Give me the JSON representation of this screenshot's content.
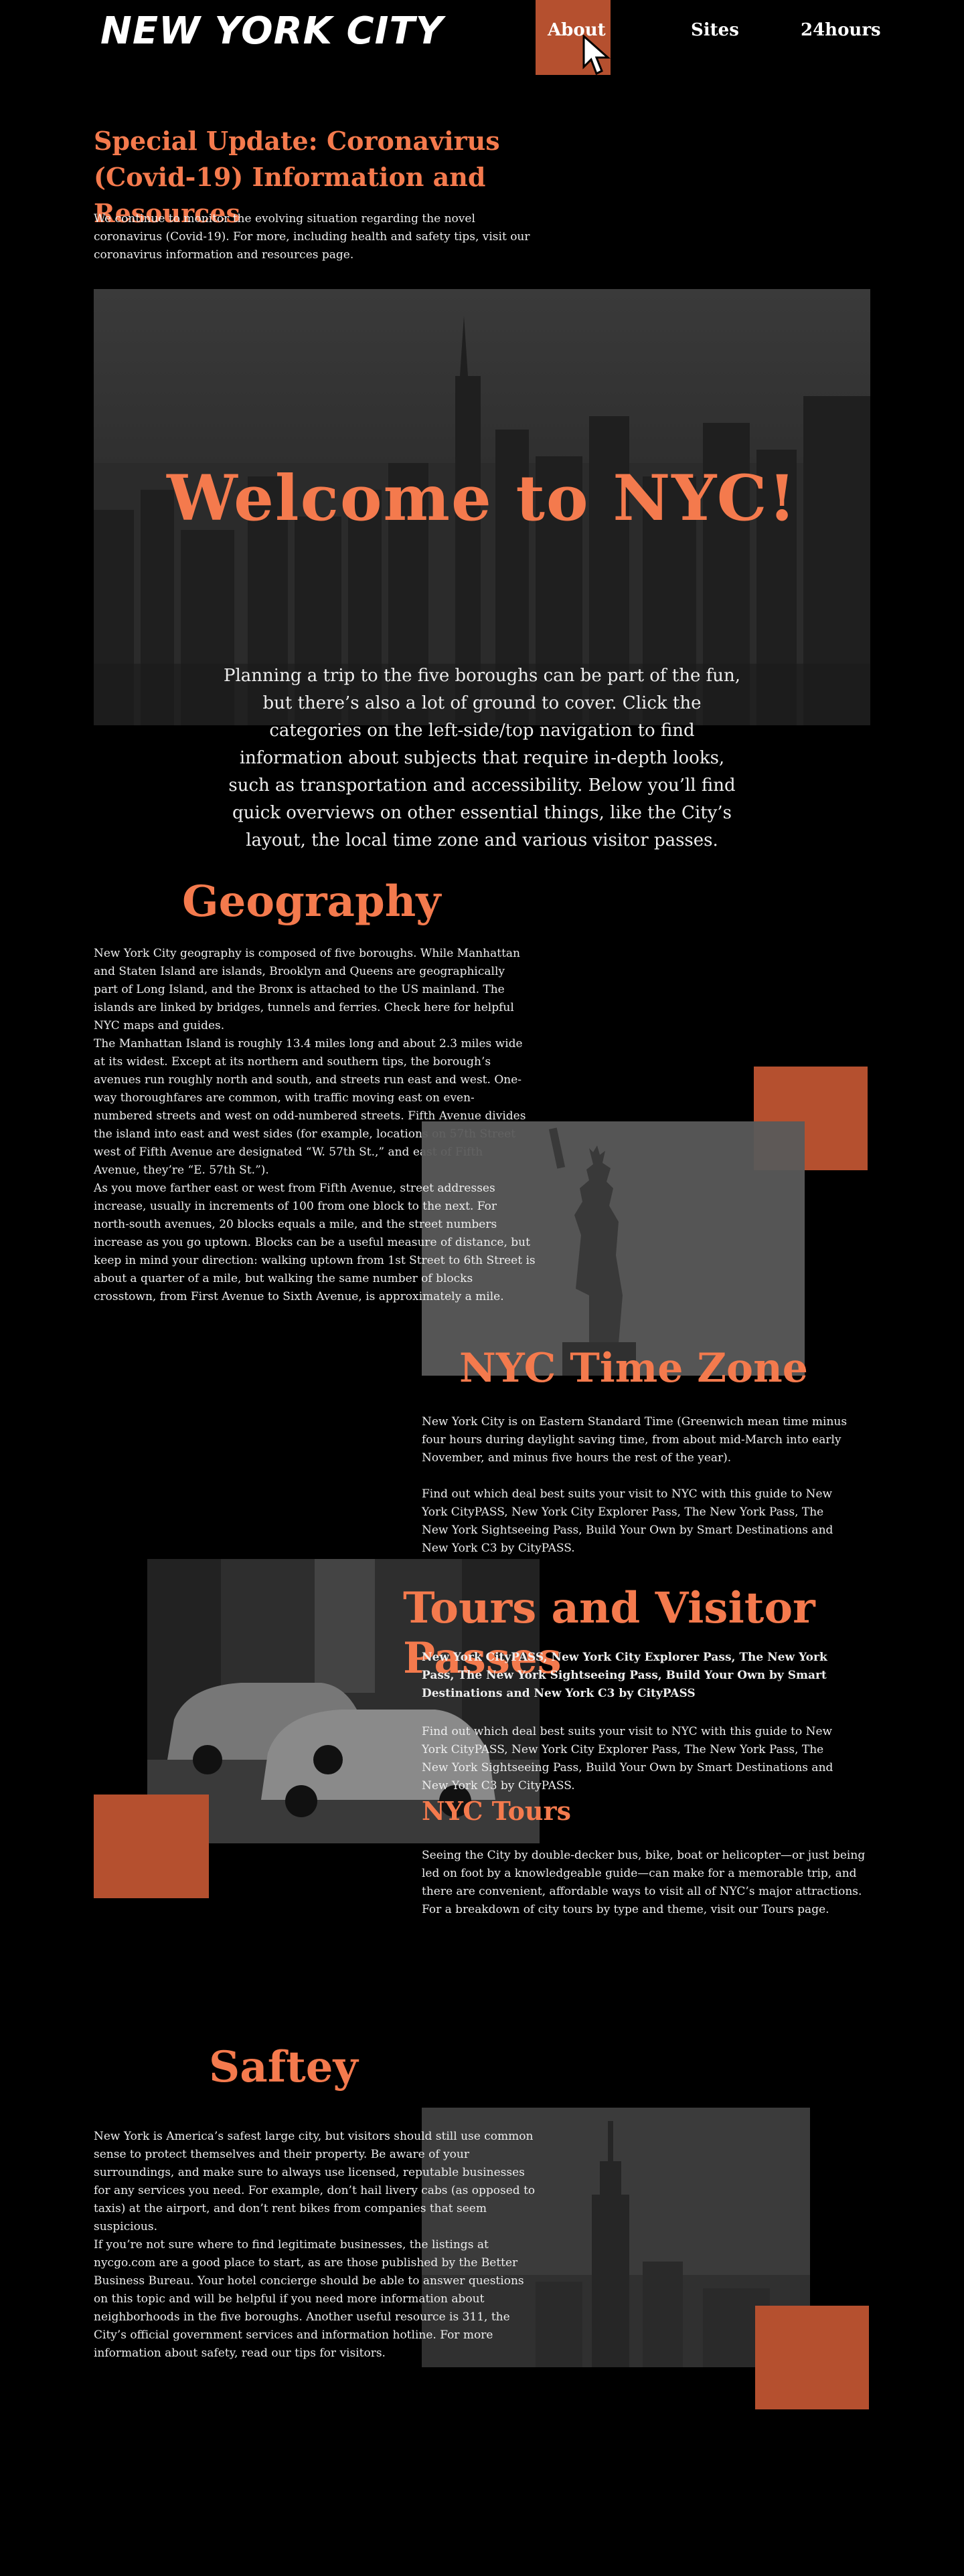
{
  "header": {
    "logo": "NEW YORK CITY",
    "nav": [
      "About",
      "Sites",
      "24hours"
    ]
  },
  "covid": {
    "title": "Special Update: Coronavirus (Covid-19) Information and Resources",
    "text": "We continue to monitor the evolving situation regarding the novel coronavirus (Covid-19). For more, including health and safety tips, visit our coronavirus information and resources page."
  },
  "hero": {
    "title": "Welcome to NYC!",
    "text": "Planning a trip to the five boroughs can be part of the fun, but there’s also a lot of ground to cover. Click the categories on the left-side/top navigation to find information about subjects that require in-depth looks, such as transportation and accessibility. Below you’ll find quick overviews on other essential things, like the City’s layout, the local time zone and various visitor passes."
  },
  "geography": {
    "title": "Geography",
    "p1": "New York City geography is composed of five boroughs.  While Manhattan and Staten Island are islands, Brooklyn and Queens are geographically part of Long Island, and the Bronx is attached to the US mainland. The islands are linked by bridges, tunnels and ferries. Check here for helpful NYC maps and guides.",
    "p2": "The Manhattan Island is roughly 13.4 miles long and about 2.3 miles wide at its widest. Except at its northern and southern tips, the borough’s avenues run roughly north and south, and streets run east and west. One-way thoroughfares are common, with traffic moving east on even-numbered streets and west on odd-numbered streets. Fifth Avenue divides the island into east and west sides (for example, locations on 57th Street west of Fifth Avenue are designated “W. 57th St.,” and east of Fifth Avenue, they’re “E. 57th St.”).",
    "p3": " As you move farther east or west from Fifth Avenue, street addresses increase, usually in increments of 100 from one block to the next. For north-south avenues, 20 blocks equals a mile, and the street numbers increase as you go uptown. Blocks can be a useful measure of distance, but keep in mind your direction: walking uptown from 1st Street to 6th Street is about a quarter of a mile, but walking the same number of blocks crosstown, from First Avenue to Sixth Avenue, is approximately a mile."
  },
  "timezone": {
    "title": "NYC Time Zone",
    "p1": "New York City is on Eastern Standard Time (Greenwich mean time minus four hours during daylight saving time, from about mid-March into early November, and minus five hours the rest of the year).",
    "p2": "Find out which deal best suits your visit to NYC with this guide to New York CityPASS, New York City Explorer Pass, The New York Pass, The New York Sightseeing Pass, Build Your Own by Smart Destinations and New York C3 by CityPASS."
  },
  "tours": {
    "title": "Tours and Visitor Passes",
    "bold": "New York CityPASS, New York City Explorer Pass, The New York Pass, The New York Sightseeing Pass, Build Your Own by Smart Destinations and New York C3 by CityPASS",
    "p1": "Find out which deal best suits your visit to NYC with this guide to New York CityPASS, New York City Explorer Pass, The New York Pass, The New York Sightseeing Pass, Build Your Own by Smart Destinations and New York C3 by CityPASS.",
    "subtitle": "NYC Tours",
    "p2": "Seeing the City by double-decker bus, bike, boat or helicopter—or just being led on foot by a knowledgeable guide—can make for a memorable trip, and there are convenient, affordable ways to visit all of NYC’s major attractions.",
    "p3": " For a breakdown of city tours by type and theme, visit our Tours page."
  },
  "safety": {
    "title": "Saftey",
    "p1": "New York is America’s safest large city, but visitors should still use common sense to protect themselves and their property. Be aware of your surroundings, and make sure to always use licensed, reputable businesses for any services you need. For example, don’t hail livery cabs (as opposed to taxis) at the airport, and don’t rent bikes from companies that seem suspicious.",
    "p2": "If you’re not sure where to find legitimate businesses, the listings at nycgo.com are a good place to start, as are those published by the Better Business Bureau. Your hotel concierge should be able to answer questions on this topic and will be helpful if you need more information about neighborhoods in the five boroughs. Another useful resource is 311, the City’s official government services and information hotline. For more information about safety, read our tips for visitors."
  },
  "colors": {
    "accent": "#f47a4d",
    "block": "#b5502f",
    "background": "#000000"
  }
}
